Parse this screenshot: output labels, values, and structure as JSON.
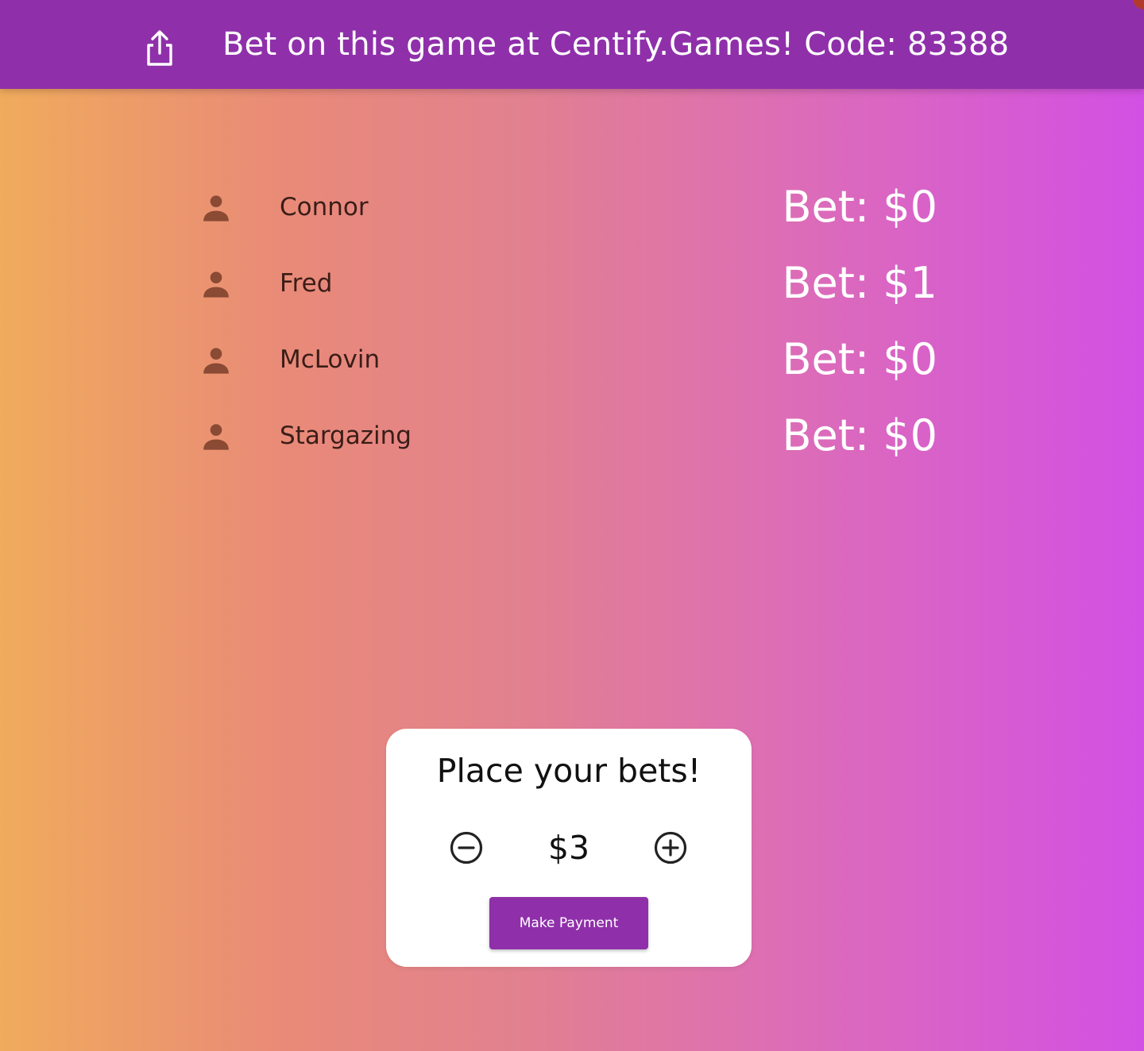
{
  "topbar": {
    "title": "Bet on this game at Centify.Games! Code: 83388",
    "share_icon": "share-icon",
    "background_color": "#8f30aa"
  },
  "players": [
    {
      "name": "Connor",
      "bet": "Bet: $0",
      "icon": "person-icon"
    },
    {
      "name": "Fred",
      "bet": "Bet: $1",
      "icon": "person-icon"
    },
    {
      "name": "McLovin",
      "bet": "Bet: $0",
      "icon": "person-icon"
    },
    {
      "name": "Stargazing",
      "bet": "Bet: $0",
      "icon": "person-icon"
    }
  ],
  "bet_panel": {
    "title": "Place your bets!",
    "amount": "$3",
    "decrement_icon": "minus-circle-icon",
    "increment_icon": "plus-circle-icon",
    "pay_label": "Make Payment"
  },
  "colors": {
    "gradient_start": "#f0ab5c",
    "gradient_end": "#d350e4",
    "player_icon": "#8a4a34",
    "accent": "#8f30aa"
  }
}
